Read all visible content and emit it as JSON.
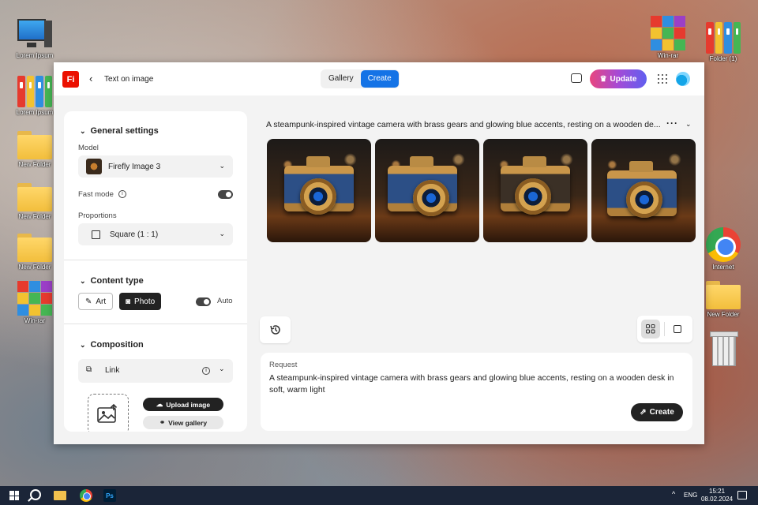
{
  "desktop": {
    "icons_left": [
      {
        "label": "Lorem Ipsum",
        "type": "pc"
      },
      {
        "label": "Lorem Ipsum",
        "type": "binders"
      },
      {
        "label": "New Folder",
        "type": "folder"
      },
      {
        "label": "New Folder",
        "type": "folder"
      },
      {
        "label": "New Folder",
        "type": "folder"
      },
      {
        "label": "Win-rar",
        "type": "winrar"
      }
    ],
    "icons_right": [
      {
        "label": "Win-rar",
        "type": "winrar"
      },
      {
        "label": "Folder (1)",
        "type": "binders"
      },
      {
        "label": "Internet",
        "type": "chrome"
      },
      {
        "label": "New Folder",
        "type": "folder"
      },
      {
        "label": "",
        "type": "trash"
      }
    ]
  },
  "app": {
    "logo": "Fi",
    "breadcrumb": "Text on image",
    "tabs": [
      {
        "label": "Gallery",
        "active": false
      },
      {
        "label": "Create",
        "active": true
      }
    ],
    "update_label": "Update",
    "accent_color": "#1473e6"
  },
  "panel": {
    "general": {
      "title": "General settings",
      "model_label": "Model",
      "model_value": "Firefly Image 3",
      "fast_mode_label": "Fast mode",
      "fast_mode_on": true,
      "proportions_label": "Proportions",
      "proportions_value": "Square (1 : 1)"
    },
    "content_type": {
      "title": "Content type",
      "art_label": "Art",
      "photo_label": "Photo",
      "selected": "Photo",
      "auto_label": "Auto",
      "auto_on": true
    },
    "composition": {
      "title": "Composition",
      "link_label": "Link",
      "upload_label": "Upload image",
      "gallery_label": "View gallery"
    }
  },
  "main": {
    "prompt_title": "A steampunk-inspired vintage camera with brass gears and glowing blue accents, resting on a wooden de...",
    "images": [
      "camera-1",
      "camera-2",
      "camera-3",
      "camera-4"
    ],
    "request_label": "Request",
    "request_text": "A steampunk-inspired vintage camera with brass gears and glowing blue accents, resting on a wooden desk in soft, warm light",
    "create_label": "Create"
  },
  "taskbar": {
    "lang": "ENG",
    "time": "15:21",
    "date": "08.02.2024"
  }
}
